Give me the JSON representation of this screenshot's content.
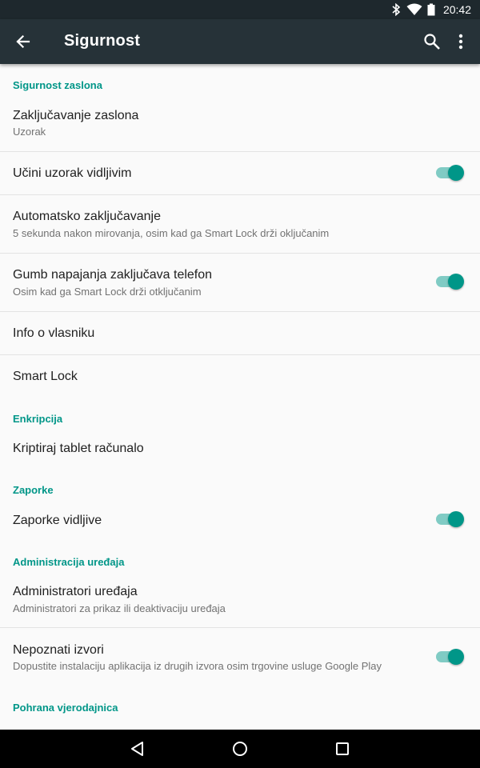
{
  "status_bar": {
    "time": "20:42",
    "icons": [
      "bluetooth-icon",
      "wifi-icon",
      "battery-icon"
    ]
  },
  "app_bar": {
    "title": "Sigurnost",
    "icons": [
      "back-arrow-icon",
      "search-icon",
      "more-vert-icon"
    ]
  },
  "colors": {
    "accent": "#009688",
    "app_bar": "#263238",
    "status_bar": "#1e282d"
  },
  "sections": {
    "screen_security": {
      "header": "Sigurnost zaslona",
      "screen_lock": {
        "title": "Zaključavanje zaslona",
        "summary": "Uzorak"
      },
      "make_pattern_visible": {
        "title": "Učini uzorak vidljivim",
        "enabled": true
      },
      "auto_lock": {
        "title": "Automatsko zaključavanje",
        "summary": "5 sekunda nakon mirovanja, osim kad ga Smart Lock drži oključanim"
      },
      "power_button_locks": {
        "title": "Gumb napajanja zaključava telefon",
        "summary": "Osim kad ga Smart Lock drži otključanim",
        "enabled": true
      },
      "owner_info": {
        "title": "Info o vlasniku"
      },
      "smart_lock": {
        "title": "Smart Lock"
      }
    },
    "encryption": {
      "header": "Enkripcija",
      "encrypt_tablet": {
        "title": "Kriptiraj tablet računalo"
      }
    },
    "passwords": {
      "header": "Zaporke",
      "passwords_visible": {
        "title": "Zaporke vidljive",
        "enabled": true
      }
    },
    "device_administration": {
      "header": "Administracija uređaja",
      "device_administrators": {
        "title": "Administratori uređaja",
        "summary": "Administratori za prikaz ili deaktivaciju uređaja"
      },
      "unknown_sources": {
        "title": "Nepoznati izvori",
        "summary": "Dopustite instalaciju aplikacija iz drugih izvora osim trgovine usluge Google Play",
        "enabled": true
      }
    },
    "credential_storage": {
      "header": "Pohrana vjerodajnica"
    }
  },
  "nav_bar": {
    "icons": [
      "back-triangle-icon",
      "home-circle-icon",
      "recents-square-icon"
    ]
  }
}
